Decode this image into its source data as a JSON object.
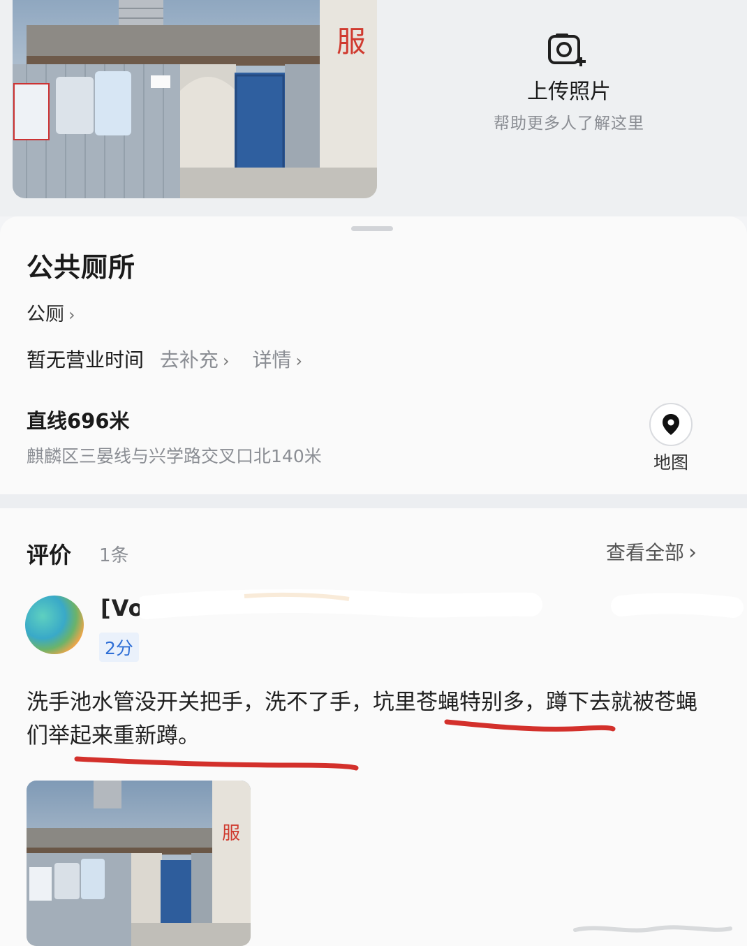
{
  "upload": {
    "title": "上传照片",
    "subtitle": "帮助更多人了解这里",
    "icon": "camera-plus-icon"
  },
  "place": {
    "name": "公共厕所",
    "category": "公厕",
    "hours": "暂无营业时间",
    "hours_action": "去补充",
    "details_link": "详情",
    "distance": "直线696米",
    "address": "麒麟区三晏线与兴学路交叉口北140米",
    "map_label": "地图"
  },
  "photo_sign_text": "服",
  "reviews": {
    "title": "评价",
    "count": "1条",
    "view_all": "查看全部",
    "items": [
      {
        "username": "[Vo",
        "score": "2分",
        "text": "洗手池水管没开关把手，洗不了手，坑里苍蝇特别多，蹲下去就被苍蝇们举起来重新蹲。"
      }
    ]
  },
  "colors": {
    "accent_blue": "#2f6fd6",
    "underline_red": "#d3302b",
    "muted": "#8b8e94"
  }
}
